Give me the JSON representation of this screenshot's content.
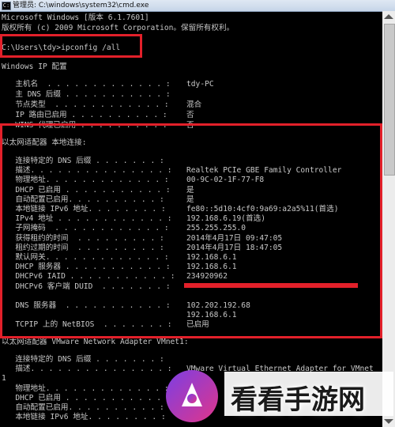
{
  "window": {
    "title": "管理员: C:\\windows\\system32\\cmd.exe",
    "icon": "cmd-icon"
  },
  "header_lines": [
    "Microsoft Windows [版本 6.1.7601]",
    "版权所有 (c) 2009 Microsoft Corporation。保留所有权利。"
  ],
  "command": "C:\\Users\\tdy>ipconfig /all",
  "section_windows_ip": "Windows IP 配置",
  "win_ip_rows": [
    {
      "k": "   主机名  . . . . . . . . . . . . . :",
      "v": "tdy-PC"
    },
    {
      "k": "   主 DNS 后缀 . . . . . . . . . . . :",
      "v": ""
    },
    {
      "k": "   节点类型  . . . . . . . . . . . . :",
      "v": "混合"
    },
    {
      "k": "   IP 路由已启用 . . . . . . . . . . :",
      "v": "否"
    },
    {
      "k": "   WINS 代理已启用 . . . . . . . . . :",
      "v": "否"
    }
  ],
  "section_local": "以太网适配器 本地连接:",
  "local_rows": [
    {
      "k": "   连接特定的 DNS 后缀 . . . . . . . :",
      "v": ""
    },
    {
      "k": "   描述. . . . . . . . . . . . . . . :",
      "v": "Realtek PCIe GBE Family Controller"
    },
    {
      "k": "   物理地址. . . . . . . . . . . . . :",
      "v": "00-9C-02-1F-77-F8"
    },
    {
      "k": "   DHCP 已启用 . . . . . . . . . . . :",
      "v": "是"
    },
    {
      "k": "   自动配置已启用. . . . . . . . . . :",
      "v": "是"
    },
    {
      "k": "   本地链接 IPv6 地址. . . . . . . . :",
      "v": "fe80::5d10:4cf0:9a69:a2a5%11(首选)"
    },
    {
      "k": "   IPv4 地址 . . . . . . . . . . . . :",
      "v": "192.168.6.19(首选)"
    },
    {
      "k": "   子网掩码  . . . . . . . . . . . . :",
      "v": "255.255.255.0"
    },
    {
      "k": "   获得租约的时间  . . . . . . . . . :",
      "v": "2014年4月17日 09:47:05"
    },
    {
      "k": "   租约过期的时间  . . . . . . . . . :",
      "v": "2014年4月17日 18:47:05"
    },
    {
      "k": "   默认网关. . . . . . . . . . . . . :",
      "v": "192.168.6.1"
    },
    {
      "k": "   DHCP 服务器 . . . . . . . . . . . :",
      "v": "192.168.6.1"
    },
    {
      "k": "   DHCPv6 IAID . . . . . . . . . . . :",
      "v": "234920962"
    },
    {
      "k": "   DHCPv6 客户端 DUID  . . . . . . . :",
      "v": ""
    },
    {
      "k": "",
      "v": ""
    },
    {
      "k": "   DNS 服务器  . . . . . . . . . . . :",
      "v": "102.202.192.68"
    },
    {
      "k": "",
      "v": "192.168.6.1"
    },
    {
      "k": "   TCPIP 上的 NetBIOS  . . . . . . . :",
      "v": "已启用"
    }
  ],
  "section_vmware": "以太网适配器 VMware Network Adapter VMnet1:",
  "vmware_rows": [
    {
      "k": "   连接特定的 DNS 后缀 . . . . . . . :",
      "v": ""
    },
    {
      "k": "   描述. . . . . . . . . . . . . . . :",
      "v": "VMware Virtual Ethernet Adapter for VMnet"
    },
    {
      "k": "1",
      "v": ""
    },
    {
      "k": "   物理地址. . . . . . . . . . . . . :",
      "v": ""
    },
    {
      "k": "   DHCP 已启用 . . . . . . . . . . . :",
      "v": ""
    },
    {
      "k": "   自动配置已启用. . . . . . . . . . :",
      "v": ""
    },
    {
      "k": "   本地链接 IPv6 地址. . . . . . . . :",
      "v": ""
    }
  ],
  "watermark": {
    "text": "看看手游网",
    "logo": "kankan-logo"
  },
  "colors": {
    "console_bg": "#000000",
    "console_text": "#c8c8c8",
    "highlight": "#e2202a"
  }
}
